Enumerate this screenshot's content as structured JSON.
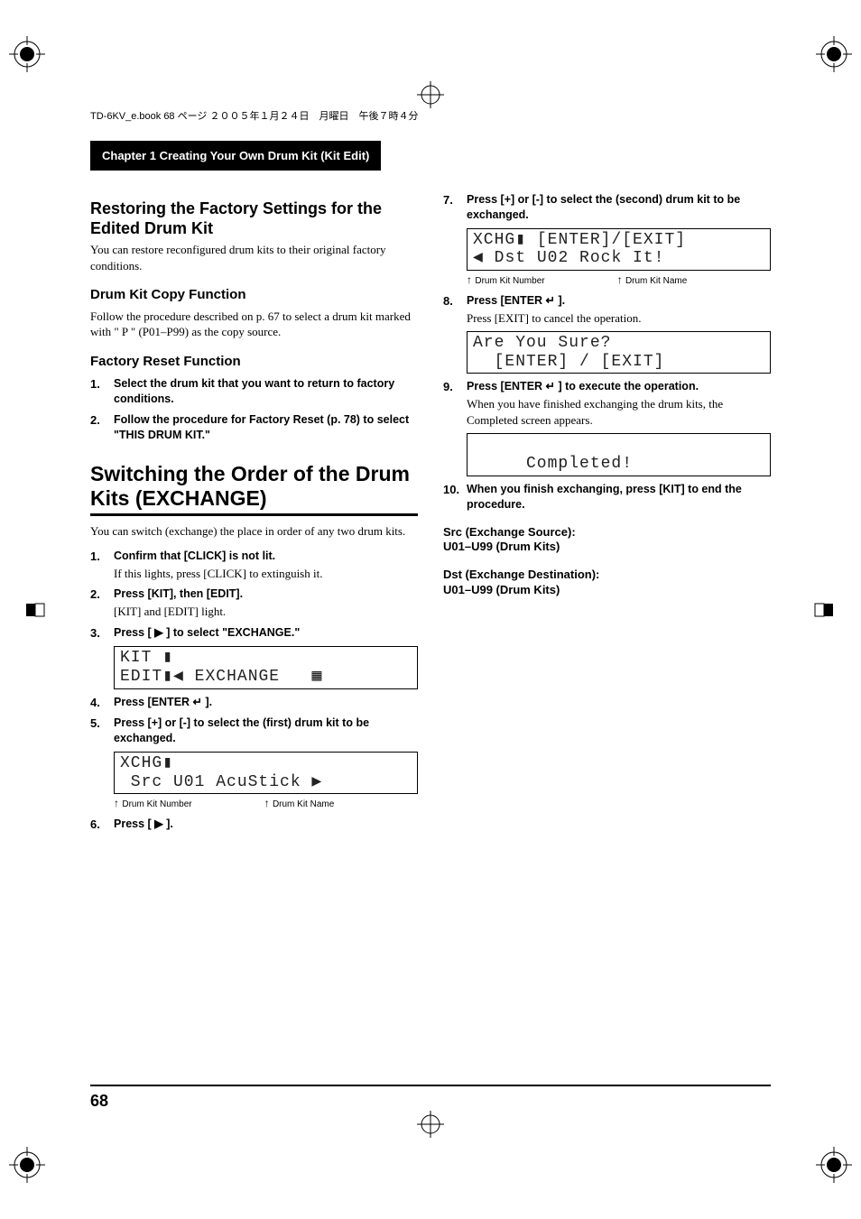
{
  "book_header": "TD-6KV_e.book  68 ページ  ２００５年１月２４日　月曜日　午後７時４分",
  "chapter_title": "Chapter 1 Creating Your Own Drum Kit (Kit Edit)",
  "left": {
    "h_restore": "Restoring the Factory Settings for the Edited Drum Kit",
    "p_restore": "You can restore reconfigured drum kits to their original factory conditions.",
    "h_copy": "Drum Kit Copy Function",
    "p_copy": "Follow the procedure described on p. 67 to select a drum kit marked with \" P \" (P01–P99) as the copy source.",
    "h_factory": "Factory Reset Function",
    "step1": "Select the drum kit that you want to return to factory conditions.",
    "step2": "Follow the procedure for Factory Reset (p. 78) to select \"THIS DRUM KIT.\"",
    "h_switch": "Switching the Order of the Drum Kits (EXCHANGE)",
    "p_switch": "You can switch (exchange) the place in order of any two drum kits.",
    "s1": "Confirm that [CLICK] is not lit.",
    "s1sub": "If this lights, press [CLICK] to extinguish it.",
    "s2": "Press [KIT], then [EDIT].",
    "s2sub": "[KIT] and [EDIT] light.",
    "s3": "Press [ ▶ ] to select \"EXCHANGE.\"",
    "lcd1_l1": "KIT ▮",
    "lcd1_l2": "EDIT▮◀ EXCHANGE   ▦",
    "s4": "Press [ENTER ↵ ].",
    "s5": "Press [+] or [-] to select the (first) drum kit to be exchanged.",
    "lcd2_l1": "XCHG▮",
    "lcd2_l2": " Src U01 AcuStick ▶",
    "annot_num": "Drum Kit Number",
    "annot_name": "Drum Kit Name",
    "s6": "Press [ ▶ ]."
  },
  "right": {
    "s7": "Press [+] or [-] to select the (second) drum kit to be exchanged.",
    "lcd3_l1": "XCHG▮ [ENTER]/[EXIT]",
    "lcd3_l2": "◀ Dst U02 Rock It!",
    "annot_num": "Drum Kit Number",
    "annot_name": "Drum Kit Name",
    "s8": "Press [ENTER ↵ ].",
    "s8sub": "Press [EXIT] to cancel the operation.",
    "lcd4_l1": "Are You Sure?",
    "lcd4_l2": "  [ENTER] / [EXIT]",
    "s9": "Press [ENTER ↵ ] to execute the operation.",
    "s9sub": "When you have finished exchanging the drum kits, the Completed screen appears.",
    "lcd5_l1": " ",
    "lcd5_l2": "     Completed!",
    "s10": "When you finish exchanging, press [KIT] to end the procedure.",
    "src1": "Src (Exchange Source):",
    "src2": "U01–U99 (Drum Kits)",
    "dst1": "Dst (Exchange Destination):",
    "dst2": "U01–U99 (Drum Kits)"
  },
  "page_number": "68"
}
